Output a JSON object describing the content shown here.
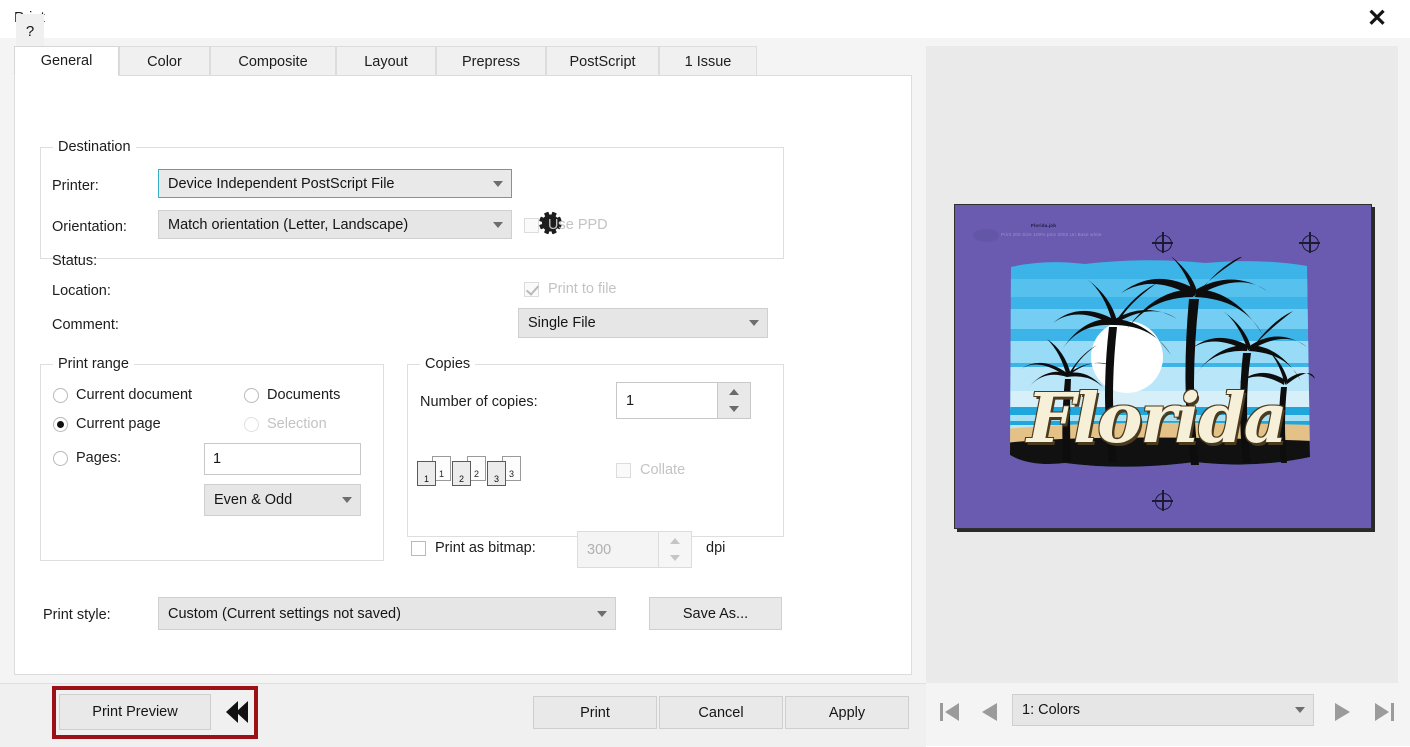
{
  "window": {
    "title": "Print",
    "close_icon": "close-icon"
  },
  "tabs": [
    {
      "label": "General",
      "active": true
    },
    {
      "label": "Color",
      "active": false
    },
    {
      "label": "Composite",
      "active": false
    },
    {
      "label": "Layout",
      "active": false
    },
    {
      "label": "Prepress",
      "active": false
    },
    {
      "label": "PostScript",
      "active": false
    },
    {
      "label": "1 Issue",
      "active": false
    }
  ],
  "destination": {
    "group_title": "Destination",
    "printer_label": "Printer:",
    "printer_value": "Device Independent PostScript File",
    "settings_icon": "gear-icon",
    "orientation_label": "Orientation:",
    "orientation_value": "Match orientation (Letter, Landscape)",
    "use_ppd_label": "Use PPD",
    "use_ppd_checked": false,
    "use_ppd_enabled": false,
    "status_label": "Status:",
    "status_value": "",
    "location_label": "Location:",
    "location_value": "",
    "print_to_file_label": "Print to file",
    "print_to_file_checked": true,
    "print_to_file_enabled": false,
    "comment_label": "Comment:",
    "comment_value": "",
    "file_mode_value": "Single File"
  },
  "print_range": {
    "group_title": "Print range",
    "options": [
      {
        "label": "Current document",
        "selected": false,
        "enabled": true
      },
      {
        "label": "Documents",
        "selected": false,
        "enabled": true
      },
      {
        "label": "Current page",
        "selected": true,
        "enabled": true
      },
      {
        "label": "Selection",
        "selected": false,
        "enabled": false
      },
      {
        "label": "Pages:",
        "selected": false,
        "enabled": true
      }
    ],
    "pages_value": "1",
    "even_odd_value": "Even & Odd"
  },
  "copies": {
    "group_title": "Copies",
    "number_label": "Number of copies:",
    "number_value": "1",
    "collate_label": "Collate",
    "collate_checked": false,
    "collate_enabled": false,
    "page_icons": [
      "1",
      "2",
      "3"
    ]
  },
  "bitmap": {
    "label": "Print as bitmap:",
    "checked": false,
    "dpi_value": "300",
    "dpi_unit": "dpi",
    "dpi_enabled": false
  },
  "print_style": {
    "label": "Print style:",
    "value": "Custom (Current settings not saved)",
    "save_as_label": "Save As..."
  },
  "footer": {
    "help_label": "?",
    "print_preview_label": "Print Preview",
    "collapse_icon": "double-chevron-left-icon",
    "print_label": "Print",
    "cancel_label": "Cancel",
    "apply_label": "Apply",
    "highlight_color": "#9c1117"
  },
  "preview": {
    "first_icon": "first-page-icon",
    "prev_icon": "previous-page-icon",
    "separation_value": "1: Colors",
    "next_icon": "next-page-icon",
    "last_icon": "last-page-icon",
    "artwork": {
      "job_name": "Florida.job",
      "job_info": "Print 200 Size  100%   pms 2002 Uri  Base white",
      "title_word": "Florida",
      "background_color": "#6a5bb0",
      "registration_icon": "registration-mark-icon"
    }
  }
}
